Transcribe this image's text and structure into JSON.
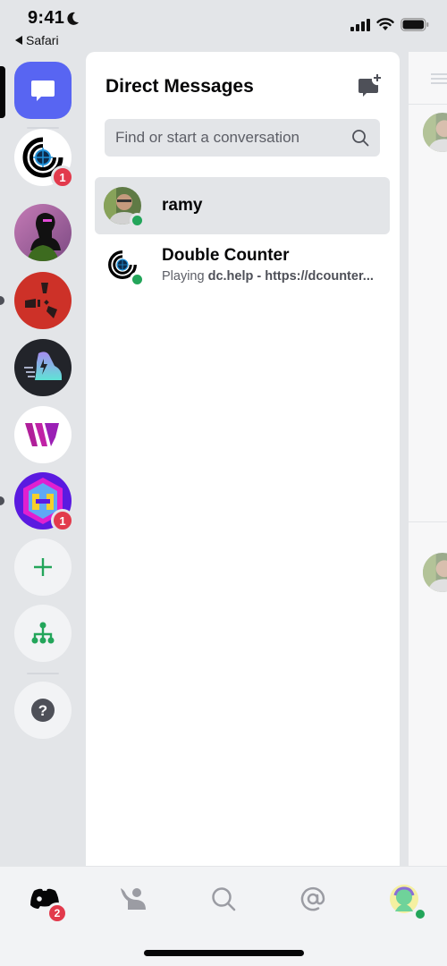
{
  "status_bar": {
    "time": "9:41",
    "back_app": "Safari",
    "icons": [
      "moon-icon",
      "signal-icon",
      "wifi-icon",
      "battery-icon"
    ]
  },
  "server_rail": {
    "items": [
      {
        "name": "direct-messages",
        "icon": "chat-bubble-icon",
        "selected": true
      },
      {
        "name": "double-counter-server",
        "icon": "crosshair-icon",
        "badge": "1"
      },
      {
        "name": "server-silhouette",
        "icon": "avatar-image"
      },
      {
        "name": "rust-server",
        "icon": "rust-logo-icon",
        "unread": true
      },
      {
        "name": "sneaker-server",
        "icon": "sneaker-icon"
      },
      {
        "name": "w-server",
        "icon": "w-logo-icon"
      },
      {
        "name": "hex-server",
        "icon": "hex-logo-icon",
        "unread": true,
        "badge": "1"
      },
      {
        "name": "add-server",
        "icon": "plus-icon"
      },
      {
        "name": "explore-servers",
        "icon": "hierarchy-icon"
      },
      {
        "name": "help",
        "icon": "question-icon"
      }
    ]
  },
  "dm_panel": {
    "title": "Direct Messages",
    "new_dm_icon": "new-message-icon",
    "search_placeholder": "Find or start a conversation",
    "conversations": [
      {
        "name": "ramy",
        "status": "online",
        "active": true
      },
      {
        "name": "Double Counter",
        "status": "online",
        "activity_prefix": "Playing ",
        "activity_bold": "dc.help - https://dcounter..."
      }
    ]
  },
  "tab_bar": {
    "tabs": [
      {
        "name": "home",
        "icon": "discord-logo-icon",
        "badge": "2",
        "active": true
      },
      {
        "name": "friends",
        "icon": "friends-wave-icon"
      },
      {
        "name": "search",
        "icon": "search-icon"
      },
      {
        "name": "mentions",
        "icon": "at-icon"
      },
      {
        "name": "profile",
        "icon": "avatar-icon",
        "status": "online"
      }
    ]
  },
  "colors": {
    "brand": "#5865f2",
    "badge": "#e23a4c",
    "online": "#23a55a",
    "rail_bg": "#e3e5e8"
  }
}
